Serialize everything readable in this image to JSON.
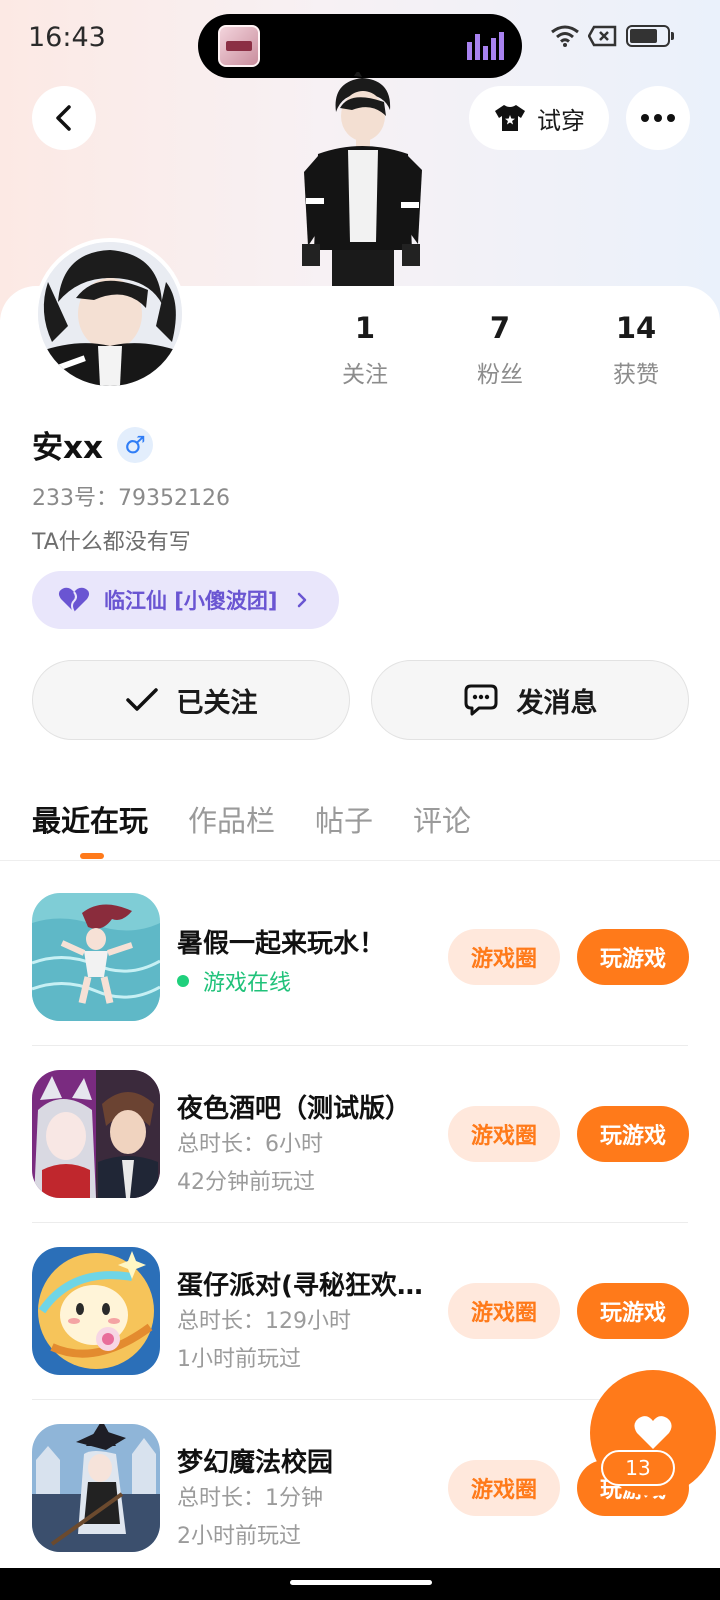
{
  "status_bar": {
    "time": "16:43",
    "battery_level": 0.68
  },
  "header": {
    "tryon_label": "试穿"
  },
  "profile": {
    "name": "安xx",
    "gender_symbol": "♂",
    "uid": "233号：79352126",
    "bio": "TA什么都没有写",
    "guild_label": "临江仙 [小傻波团]",
    "stats": [
      {
        "value": "1",
        "label": "关注"
      },
      {
        "value": "7",
        "label": "粉丝"
      },
      {
        "value": "14",
        "label": "获赞"
      }
    ]
  },
  "actions": {
    "follow_label": "已关注",
    "message_label": "发消息"
  },
  "tabs": [
    {
      "label": "最近在玩",
      "active": true
    },
    {
      "label": "作品栏",
      "active": false
    },
    {
      "label": "帖子",
      "active": false
    },
    {
      "label": "评论",
      "active": false
    }
  ],
  "games": [
    {
      "title": "暑假一起来玩水！",
      "status": "游戏在线",
      "duration": "",
      "last_played": "",
      "circle_label": "游戏圈",
      "play_label": "玩游戏"
    },
    {
      "title": "夜色酒吧（测试版）",
      "status": "",
      "duration": "总时长：6小时",
      "last_played": "42分钟前玩过",
      "circle_label": "游戏圈",
      "play_label": "玩游戏"
    },
    {
      "title": "蛋仔派对(寻秘狂欢…",
      "status": "",
      "duration": "总时长：129小时",
      "last_played": "1小时前玩过",
      "circle_label": "游戏圈",
      "play_label": "玩游戏"
    },
    {
      "title": "梦幻魔法校园",
      "status": "",
      "duration": "总时长：1分钟",
      "last_played": "2小时前玩过",
      "circle_label": "游戏圈",
      "play_label": "玩游戏"
    }
  ],
  "fab": {
    "count": "13"
  },
  "colors": {
    "accent": "#ff7a1a",
    "guild": "#6a55d2",
    "online": "#20c27a"
  }
}
